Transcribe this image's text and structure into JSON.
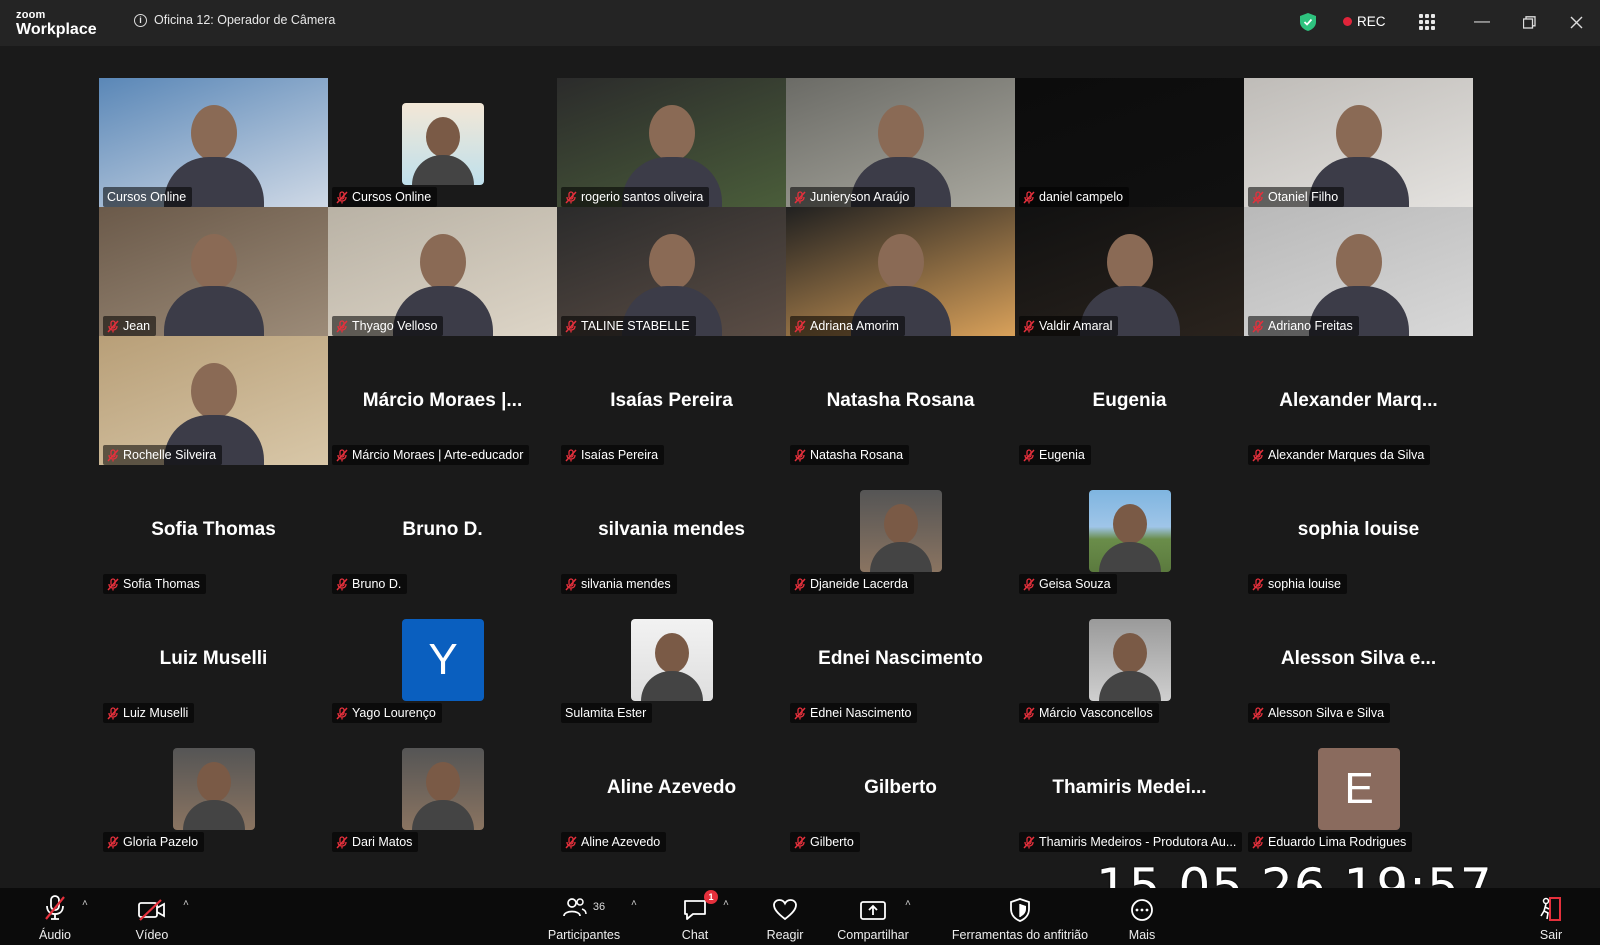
{
  "app": {
    "logo_line1": "zoom",
    "logo_line2": "Workplace",
    "meeting_title": "Oficina 12: Operador de Câmera",
    "rec_label": "REC"
  },
  "tiles": [
    {
      "name": "Cursos Online",
      "kind": "video",
      "muted": false,
      "active": true
    },
    {
      "name": "Cursos Online",
      "kind": "avatar-illustration",
      "muted": true
    },
    {
      "name": "rogerio santos oliveira",
      "kind": "video",
      "muted": true
    },
    {
      "name": "Junieryson Araújo",
      "kind": "video",
      "muted": true
    },
    {
      "name": "daniel campelo",
      "kind": "video-dark",
      "muted": true
    },
    {
      "name": "Otaniel Filho",
      "kind": "video",
      "muted": true
    },
    {
      "name": "Jean",
      "kind": "video",
      "muted": true
    },
    {
      "name": "Thyago Velloso",
      "kind": "video",
      "muted": true
    },
    {
      "name": "TALINE STABELLE",
      "kind": "video",
      "muted": true
    },
    {
      "name": "Adriana Amorim",
      "kind": "video",
      "muted": true
    },
    {
      "name": "Valdir Amaral",
      "kind": "video",
      "muted": true
    },
    {
      "name": "Adriano Freitas",
      "kind": "video",
      "muted": true
    },
    {
      "name": "Rochelle Silveira",
      "kind": "video",
      "muted": true
    },
    {
      "name": "Márcio Moraes | Arte-educador",
      "big": "Márcio  Moraes  |...",
      "kind": "name",
      "muted": true
    },
    {
      "name": "Isaías Pereira",
      "big": "Isaías Pereira",
      "kind": "name",
      "muted": true
    },
    {
      "name": "Natasha Rosana",
      "big": "Natasha Rosana",
      "kind": "name",
      "muted": true
    },
    {
      "name": "Eugenia",
      "big": "Eugenia",
      "kind": "name",
      "muted": true
    },
    {
      "name": "Alexander Marques da Silva",
      "big": "Alexander  Marq...",
      "kind": "name",
      "muted": true
    },
    {
      "name": "Sofia Thomas",
      "big": "Sofia Thomas",
      "kind": "name",
      "muted": true
    },
    {
      "name": "Bruno D.",
      "big": "Bruno D.",
      "kind": "name",
      "muted": true
    },
    {
      "name": "silvania mendes",
      "big": "silvania mendes",
      "kind": "name",
      "muted": true
    },
    {
      "name": "Djaneide Lacerda",
      "kind": "photo",
      "muted": true
    },
    {
      "name": "Geisa Souza",
      "kind": "photo",
      "muted": true
    },
    {
      "name": "sophia louise",
      "big": "sophia louise",
      "kind": "name",
      "muted": true
    },
    {
      "name": "Luiz Muselli",
      "big": "Luiz Muselli",
      "kind": "name",
      "muted": true
    },
    {
      "name": "Yago Lourenço",
      "kind": "letter",
      "letter": "Y",
      "muted": true
    },
    {
      "name": "Sulamita Ester",
      "kind": "photo",
      "muted": false
    },
    {
      "name": "Ednei Nascimento",
      "big": "Ednei Nascimento",
      "kind": "name",
      "muted": true
    },
    {
      "name": "Márcio Vasconcellos",
      "kind": "photo",
      "muted": true
    },
    {
      "name": "Alesson Silva e Silva",
      "big": "Alesson  Silva  e...",
      "kind": "name",
      "muted": true
    },
    {
      "name": "Gloria Pazelo",
      "kind": "photo",
      "muted": true
    },
    {
      "name": "Dari Matos",
      "kind": "photo",
      "muted": true
    },
    {
      "name": "Aline Azevedo",
      "big": "Aline Azevedo",
      "kind": "name",
      "muted": true
    },
    {
      "name": "Gilberto",
      "big": "Gilberto",
      "kind": "name",
      "muted": true
    },
    {
      "name": "Thamiris Medeiros - Produtora Au...",
      "big": "Thamiris  Medei...",
      "kind": "name",
      "muted": true
    },
    {
      "name": "Eduardo Lima Rodrigues",
      "kind": "letter",
      "letter": "E",
      "muted": true
    }
  ],
  "toolbar": {
    "audio": "Áudio",
    "video": "Vídeo",
    "participants": "Participantes",
    "participants_count": "36",
    "chat": "Chat",
    "chat_badge": "1",
    "react": "Reagir",
    "share": "Compartilhar",
    "host_tools": "Ferramentas do anfitrião",
    "more": "Mais",
    "leave": "Sair"
  },
  "overlay_timestamp": "15.05.26 19:57",
  "colors": {
    "active_speaker": "#2ec27e",
    "rec": "#e0243a",
    "shield": "#2ec27e",
    "yago_avatar": "#0a5fbf",
    "eduardo_avatar": "#8a6b5e"
  }
}
